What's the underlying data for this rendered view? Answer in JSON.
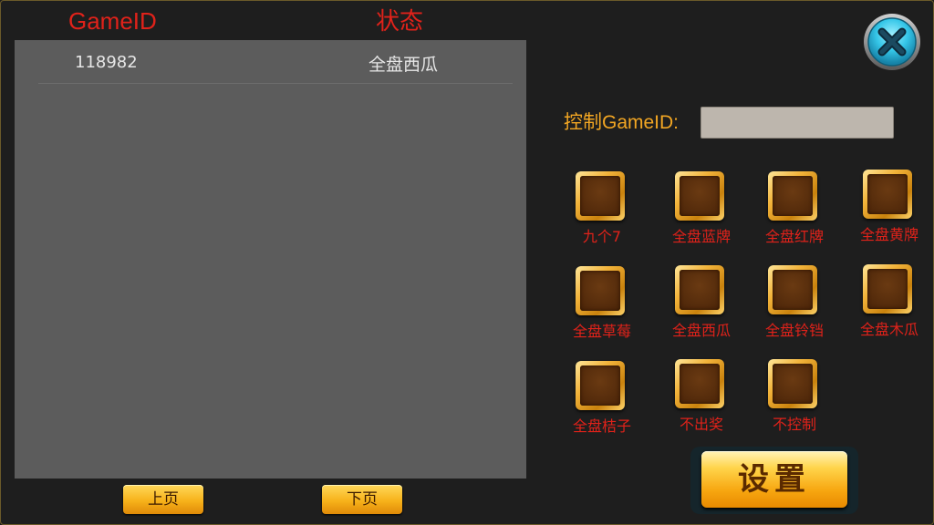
{
  "list": {
    "headers": {
      "gameid": "GameID",
      "status": "状态"
    },
    "rows": [
      {
        "gameid": "118982",
        "status": "全盘西瓜"
      }
    ],
    "prev_label": "上页",
    "next_label": "下页"
  },
  "control": {
    "label": "控制GameID:",
    "input_value": "",
    "input_placeholder": ""
  },
  "options": [
    "九个7",
    "全盘蓝牌",
    "全盘红牌",
    "全盘黄牌",
    "全盘草莓",
    "全盘西瓜",
    "全盘铃铛",
    "全盘木瓜",
    "全盘桔子",
    "不出奖",
    "不控制"
  ],
  "set_label": "设置",
  "icons": {
    "close": "close-icon"
  },
  "colors": {
    "header_red": "#e0221a",
    "label_orange": "#f2a623",
    "gold": "#f7b21a",
    "close_cyan": "#35c6e8"
  }
}
